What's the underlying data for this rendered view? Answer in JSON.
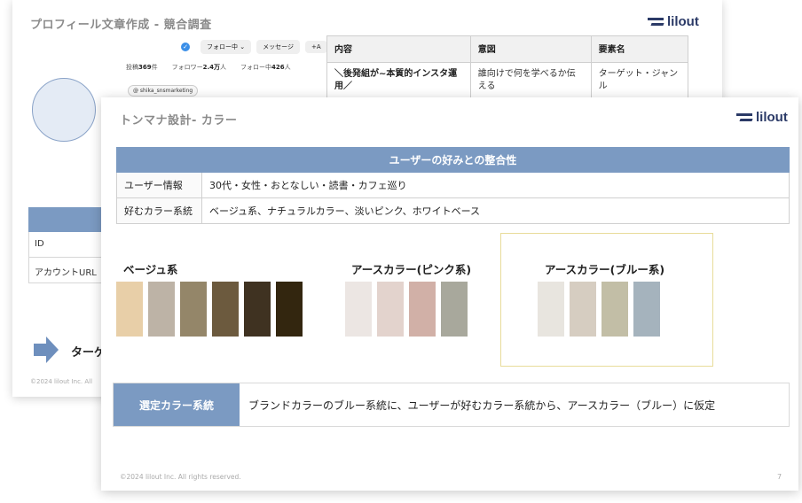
{
  "back_slide": {
    "title": "プロフィール文章作成 - 競合調査",
    "logo_text": "lilout",
    "profile": {
      "follow_button": "フォロー中 ⌄",
      "message_button": "メッセージ",
      "add_button": "+A",
      "posts_label": "投稿",
      "posts_value": "369",
      "posts_unit": "件",
      "followers_label": "フォロワー",
      "followers_value": "2.4万",
      "followers_unit": "人",
      "following_label": "フォロー中",
      "following_value": "426",
      "following_unit": "人",
      "handle": "shika_snsmarketing"
    },
    "table": {
      "headers": [
        "内容",
        "意図",
        "要素名"
      ],
      "row": [
        "＼後発組が~本質的インスタ運用／",
        "誰向けで何を学べるか伝える",
        "ターゲット・ジャンル"
      ]
    },
    "left_table_rows": [
      "ID",
      "アカウントURL"
    ],
    "target_text": "ターゲ",
    "footer": "©2024 lilout Inc. All"
  },
  "front_slide": {
    "title": "トンマナ設計- カラー",
    "logo_text": "lilout",
    "table": {
      "header": "ユーザーの好みとの整合性",
      "rows": [
        {
          "label": "ユーザー情報",
          "value": "30代・女性・おとなしい・読書・カフェ巡り"
        },
        {
          "label": "好むカラー系統",
          "value": "ベージュ系、ナチュラルカラー、淡いピンク、ホワイトベース"
        }
      ]
    },
    "palettes": [
      {
        "title": "ベージュ系",
        "colors": [
          "#e8cfa8",
          "#bdb3a6",
          "#948669",
          "#6c5a3e",
          "#3f3221",
          "#33260f"
        ]
      },
      {
        "title": "アースカラー(ピンク系)",
        "colors": [
          "#ece6e3",
          "#e3d3cd",
          "#d1b0a7",
          "#a8a89c"
        ]
      },
      {
        "title": "アースカラー(ブルー系)",
        "colors": [
          "#e8e5df",
          "#d6cdc1",
          "#c2bea6",
          "#a5b3bd"
        ]
      }
    ],
    "selected": {
      "label": "選定カラー系統",
      "text": "ブランドカラーのブルー系統に、ユーザーが好むカラー系統から、アースカラー（ブルー）に仮定"
    },
    "footer": "©2024 lilout Inc. All rights reserved.",
    "page_number": "7"
  }
}
